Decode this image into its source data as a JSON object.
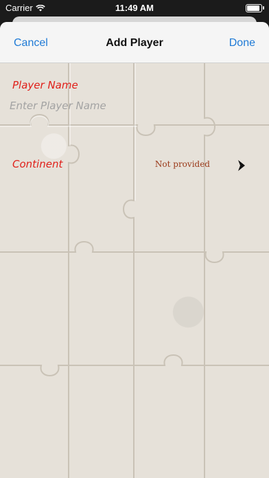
{
  "status_bar": {
    "carrier": "Carrier",
    "time": "11:49 AM"
  },
  "nav": {
    "cancel_label": "Cancel",
    "title": "Add Player",
    "done_label": "Done"
  },
  "form": {
    "player_name_label": "Player Name",
    "player_name_placeholder": "Enter Player Name",
    "player_name_value": "",
    "continent_label": "Continent",
    "continent_value": "Not provided"
  },
  "colors": {
    "accent": "#1e7ad6",
    "label_red": "#e0201a",
    "value_brown": "#9a3a1a",
    "background": "#e6e1d9"
  },
  "icons": [
    "wifi-icon",
    "battery-icon",
    "chevron-right-icon"
  ]
}
